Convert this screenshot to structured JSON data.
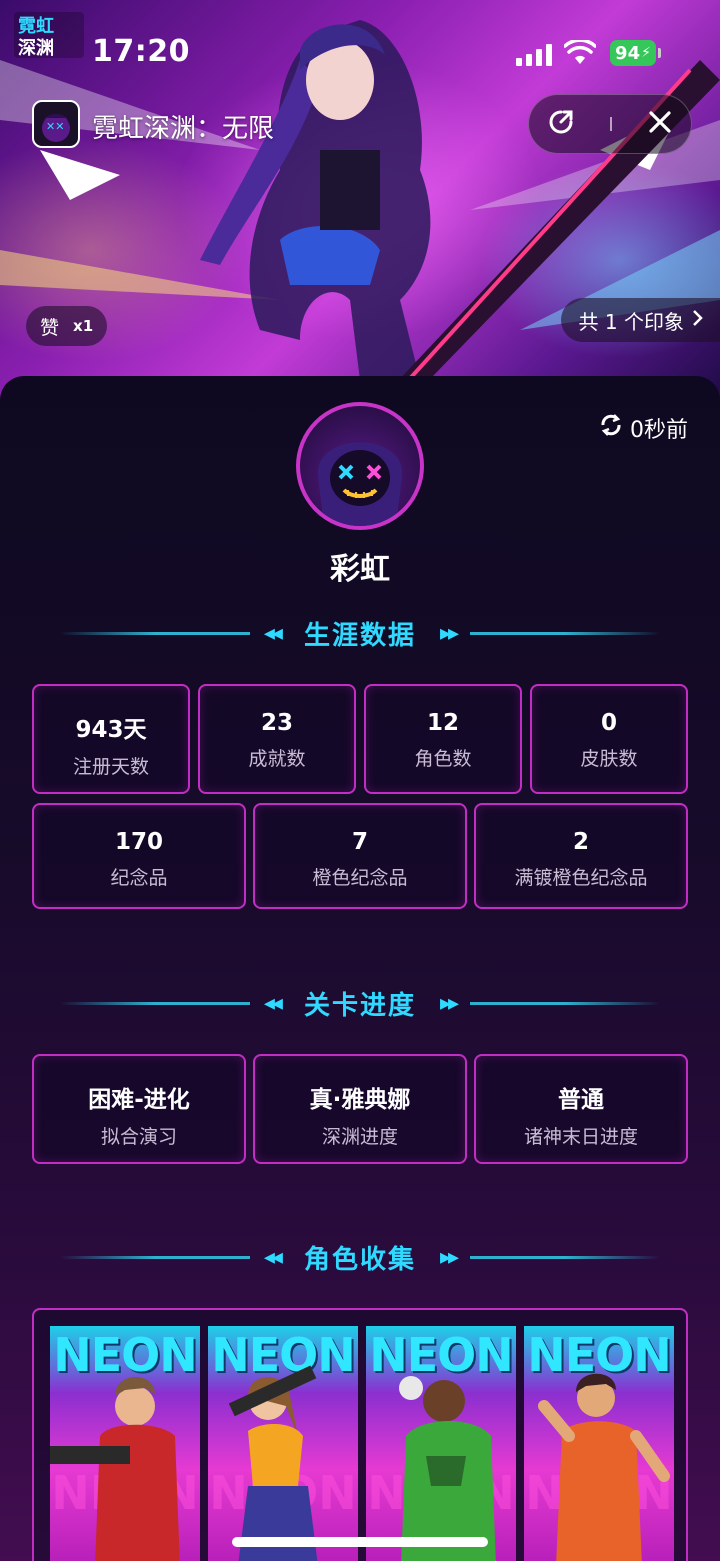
{
  "status_bar": {
    "time": "17:20",
    "battery": "94"
  },
  "logo": {
    "line1": "霓虹",
    "line2": "深渊"
  },
  "app": {
    "title": "霓虹深渊：无限",
    "share_icon": "share-icon",
    "close_icon": "close-icon"
  },
  "hero": {
    "like_label": "赞",
    "like_count": "x1",
    "impression_label": "共 1 个印象"
  },
  "profile": {
    "refresh_label": "0秒前",
    "nickname": "彩虹"
  },
  "sections": {
    "career": "生涯数据",
    "progress": "关卡进度",
    "characters": "角色收集"
  },
  "career_stats": [
    {
      "value": "943天",
      "label": "注册天数"
    },
    {
      "value": "23",
      "label": "成就数"
    },
    {
      "value": "12",
      "label": "角色数"
    },
    {
      "value": "0",
      "label": "皮肤数"
    },
    {
      "value": "170",
      "label": "纪念品"
    },
    {
      "value": "7",
      "label": "橙色纪念品"
    },
    {
      "value": "2",
      "label": "满镀橙色纪念品"
    }
  ],
  "progress_stats": [
    {
      "value": "困难-进化",
      "label": "拟合演习"
    },
    {
      "value": "真·雅典娜",
      "label": "深渊进度"
    },
    {
      "value": "普通",
      "label": "诸神末日进度"
    }
  ],
  "character_cards": [
    {
      "badge": "NEON"
    },
    {
      "badge": "NEON"
    },
    {
      "badge": "NEON"
    },
    {
      "badge": "NEON"
    }
  ],
  "colors": {
    "accent_cyan": "#2fd9ff",
    "card_border": "#c22ec3",
    "battery_green": "#35c759"
  }
}
